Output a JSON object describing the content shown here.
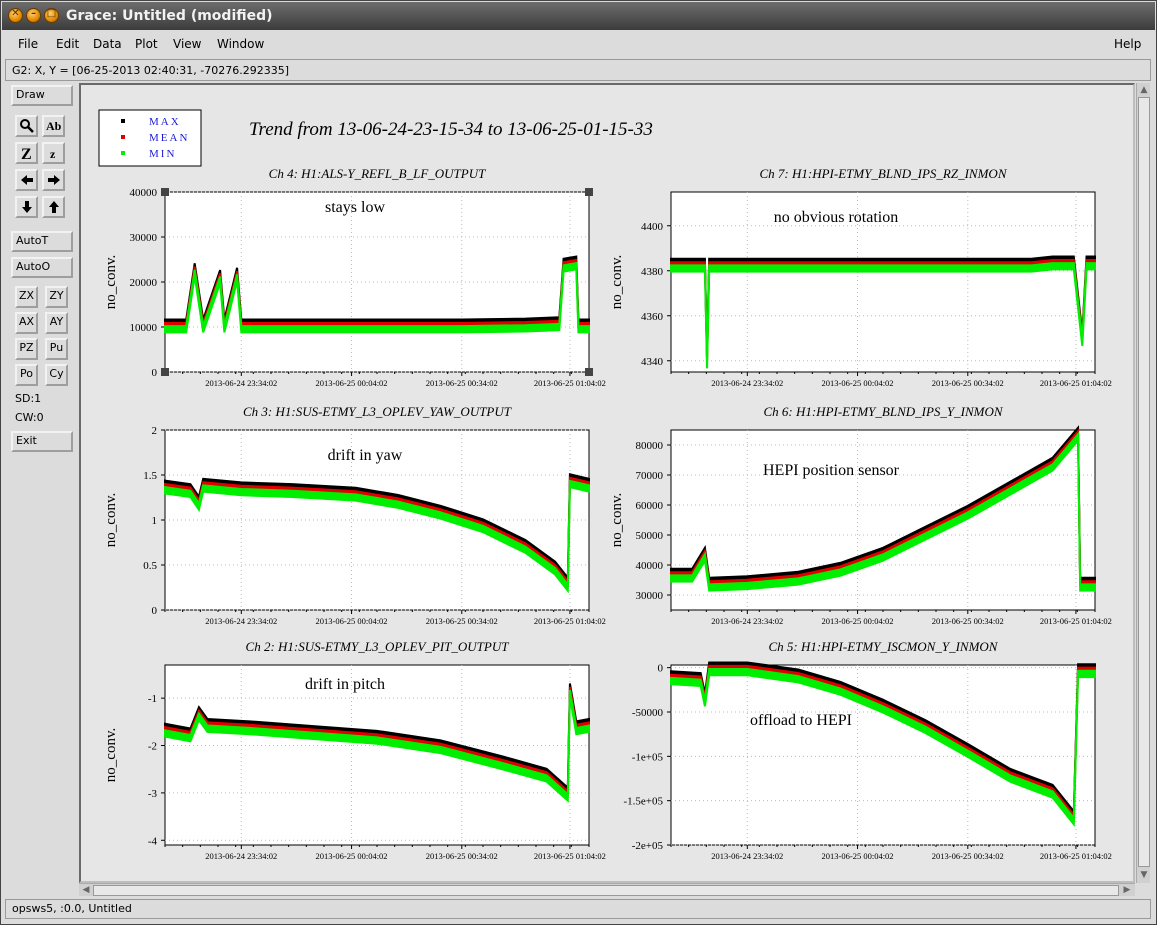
{
  "window": {
    "title": "Grace: Untitled (modified)"
  },
  "titlebar_buttons": [
    "close",
    "minimize",
    "maximize"
  ],
  "menubar": {
    "items": [
      "File",
      "Edit",
      "Data",
      "Plot",
      "View",
      "Window"
    ],
    "help": "Help"
  },
  "coord_readout": "G2: X, Y = [06-25-2013 02:40:31, -70276.292335]",
  "toolbar": {
    "draw": "Draw",
    "autot": "AutoT",
    "autoo": "AutoO",
    "zx": "ZX",
    "zy": "ZY",
    "ax": "AX",
    "ay": "AY",
    "pz": "PZ",
    "pu": "Pu",
    "po": "Po",
    "cy": "Cy",
    "sd": "SD:1",
    "cw": "CW:0",
    "exit": "Exit",
    "icons": [
      "zoom-icon",
      "text-icon",
      "zoom-x-icon",
      "zoom-small-icon",
      "arrow-left-icon",
      "arrow-right-icon",
      "arrow-down-icon",
      "arrow-up-icon"
    ]
  },
  "status": "opsws5, :0.0, Untitled",
  "chart_data": {
    "title": "Trend from 13-06-24-23-15-34 to 13-06-25-01-15-33",
    "legend": {
      "placement": "top-left",
      "entries": [
        {
          "name": "MAX",
          "color": "#000000"
        },
        {
          "name": "MEAN",
          "color": "#e00000"
        },
        {
          "name": "MIN",
          "color": "#00ee00"
        }
      ]
    },
    "x_ticks": [
      "2013-06-24 23:34:02",
      "2013-06-25 00:04:02",
      "2013-06-25 00:34:02",
      "2013-06-25 01:04:02"
    ],
    "panels": [
      {
        "title": "Ch 4: H1:ALS-Y_REFL_B_LF_OUTPUT",
        "ylabel": "no_conv.",
        "ylim": [
          0,
          40000
        ],
        "y_ticks": [
          "0",
          "10000",
          "20000",
          "30000",
          "40000"
        ],
        "annotation": "stays low",
        "grid": true,
        "series_points": [
          [
            0,
            10500
          ],
          [
            0.05,
            10500
          ],
          [
            0.07,
            23000
          ],
          [
            0.09,
            10500
          ],
          [
            0.13,
            21500
          ],
          [
            0.14,
            10500
          ],
          [
            0.17,
            22000
          ],
          [
            0.18,
            10500
          ],
          [
            0.3,
            10500
          ],
          [
            0.5,
            10500
          ],
          [
            0.7,
            10500
          ],
          [
            0.85,
            10700
          ],
          [
            0.93,
            11000
          ],
          [
            0.94,
            24000
          ],
          [
            0.97,
            24500
          ],
          [
            0.975,
            10500
          ],
          [
            1.0,
            10500
          ]
        ]
      },
      {
        "title": "Ch 7: H1:HPI-ETMY_BLND_IPS_RZ_INMON",
        "ylabel": "no_conv.",
        "ylim": [
          4335,
          4415
        ],
        "y_ticks": [
          "4340",
          "4360",
          "4380",
          "4400"
        ],
        "annotation": "no obvious rotation",
        "grid": true,
        "series_points": [
          [
            0,
            4383
          ],
          [
            0.08,
            4383
          ],
          [
            0.085,
            4340
          ],
          [
            0.09,
            4383
          ],
          [
            0.18,
            4383
          ],
          [
            0.3,
            4383
          ],
          [
            0.5,
            4383
          ],
          [
            0.7,
            4383
          ],
          [
            0.85,
            4383
          ],
          [
            0.9,
            4384
          ],
          [
            0.95,
            4384
          ],
          [
            0.97,
            4350
          ],
          [
            0.98,
            4384
          ],
          [
            1.0,
            4384
          ]
        ]
      },
      {
        "title": "Ch 3: H1:SUS-ETMY_L3_OPLEV_YAW_OUTPUT",
        "ylabel": "no_conv.",
        "ylim": [
          0,
          2
        ],
        "y_ticks": [
          "0",
          "0.5",
          "1",
          "1.5",
          "2"
        ],
        "annotation": "drift in yaw",
        "grid": true,
        "series_points": [
          [
            0,
            1.38
          ],
          [
            0.06,
            1.34
          ],
          [
            0.08,
            1.2
          ],
          [
            0.09,
            1.4
          ],
          [
            0.18,
            1.36
          ],
          [
            0.3,
            1.34
          ],
          [
            0.45,
            1.3
          ],
          [
            0.55,
            1.22
          ],
          [
            0.65,
            1.1
          ],
          [
            0.75,
            0.95
          ],
          [
            0.85,
            0.72
          ],
          [
            0.92,
            0.48
          ],
          [
            0.95,
            0.3
          ],
          [
            0.955,
            1.45
          ],
          [
            1.0,
            1.4
          ]
        ]
      },
      {
        "title": "Ch 6: H1:HPI-ETMY_BLND_IPS_Y_INMON",
        "ylabel": "no_conv.",
        "ylim": [
          25000,
          85000
        ],
        "y_ticks": [
          "30000",
          "40000",
          "50000",
          "60000",
          "70000",
          "80000"
        ],
        "annotation": "HEPI position sensor",
        "grid": true,
        "series_points": [
          [
            0,
            37000
          ],
          [
            0.05,
            37000
          ],
          [
            0.08,
            44000
          ],
          [
            0.09,
            34000
          ],
          [
            0.18,
            34500
          ],
          [
            0.3,
            36000
          ],
          [
            0.4,
            39000
          ],
          [
            0.5,
            44000
          ],
          [
            0.6,
            51000
          ],
          [
            0.7,
            58000
          ],
          [
            0.8,
            66000
          ],
          [
            0.9,
            74000
          ],
          [
            0.96,
            84000
          ],
          [
            0.965,
            34000
          ],
          [
            1.0,
            34000
          ]
        ]
      },
      {
        "title": "Ch 2: H1:SUS-ETMY_L3_OPLEV_PIT_OUTPUT",
        "ylabel": "no_conv.",
        "ylim": [
          -4.1,
          -0.3
        ],
        "y_ticks": [
          "-4",
          "-3",
          "-2",
          "-1"
        ],
        "annotation": "drift in pitch",
        "grid": true,
        "series_points": [
          [
            0,
            -1.65
          ],
          [
            0.06,
            -1.75
          ],
          [
            0.08,
            -1.3
          ],
          [
            0.1,
            -1.55
          ],
          [
            0.2,
            -1.6
          ],
          [
            0.35,
            -1.7
          ],
          [
            0.5,
            -1.8
          ],
          [
            0.65,
            -2.0
          ],
          [
            0.8,
            -2.35
          ],
          [
            0.9,
            -2.6
          ],
          [
            0.95,
            -3.0
          ],
          [
            0.955,
            -0.8
          ],
          [
            0.97,
            -1.6
          ],
          [
            1.0,
            -1.55
          ]
        ]
      },
      {
        "title": "Ch 5: H1:HPI-ETMY_ISCMON_Y_INMON",
        "ylabel": "",
        "ylim": [
          -200000,
          3000
        ],
        "y_ticks": [
          "0",
          "-50000",
          "-1e+05",
          "-1.5e+05",
          "-2e+05"
        ],
        "annotation": "offload to HEPI",
        "grid": true,
        "series_points": [
          [
            0,
            -10000
          ],
          [
            0.07,
            -12000
          ],
          [
            0.08,
            -35000
          ],
          [
            0.09,
            0
          ],
          [
            0.18,
            0
          ],
          [
            0.3,
            -8000
          ],
          [
            0.4,
            -22000
          ],
          [
            0.5,
            -42000
          ],
          [
            0.6,
            -65000
          ],
          [
            0.7,
            -92000
          ],
          [
            0.8,
            -120000
          ],
          [
            0.9,
            -138000
          ],
          [
            0.95,
            -168000
          ],
          [
            0.96,
            -2000
          ],
          [
            1.0,
            -2000
          ]
        ]
      }
    ]
  }
}
